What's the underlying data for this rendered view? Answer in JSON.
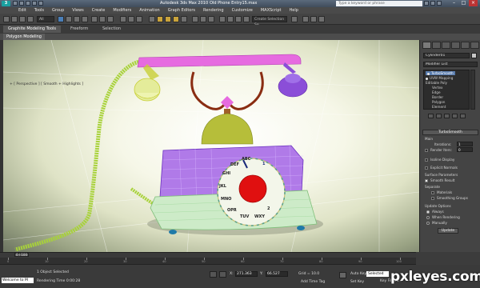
{
  "app": {
    "logo": "3",
    "title": "Autodesk 3ds Max  2010",
    "file": "Old Phone Entry15.max",
    "search_placeholder": "Type a keyword or phrase",
    "window_buttons": [
      "–",
      "□",
      "×"
    ]
  },
  "menubar": [
    "Edit",
    "Tools",
    "Group",
    "Views",
    "Create",
    "Modifiers",
    "Animation",
    "Graph Editors",
    "Rendering",
    "Customize",
    "MAXScript",
    "Help"
  ],
  "toolbar": {
    "selection_set": "Create Selection Se",
    "filter": "All"
  },
  "ribbon": {
    "tabs": [
      "Graphite Modeling Tools",
      "Freeform",
      "Selection"
    ],
    "subtab": "Polygon Modeling"
  },
  "viewport": {
    "label": "+ [ Perspective ] [ Smooth + Highlights ]"
  },
  "dial": {
    "letters": [
      "ABC",
      "DEF",
      "GHI",
      "JKL",
      "MNO",
      "PRS",
      "TUV",
      "WXY",
      "OPR",
      "TUV"
    ],
    "numbers": [
      "1",
      "2",
      "3",
      "4",
      "5",
      "6",
      "7",
      "8",
      "9",
      "0"
    ]
  },
  "command_panel": {
    "object_name": "Cylinder01",
    "modifier_list": "Modifier List",
    "stack": [
      {
        "label": "TurboSmooth",
        "selected": true
      },
      {
        "label": "UVW Mapping",
        "selected": false
      },
      {
        "label": "Editable Poly",
        "selected": false
      },
      {
        "label": "Vertex",
        "selected": false
      },
      {
        "label": "Edge",
        "selected": false
      },
      {
        "label": "Border",
        "selected": false
      },
      {
        "label": "Polygon",
        "selected": false
      },
      {
        "label": "Element",
        "selected": false
      }
    ],
    "rollout_title": "TurboSmooth",
    "main_label": "Main",
    "iterations_label": "Iterations:",
    "iterations_value": "1",
    "render_iters_label": "Render Iters:",
    "render_iters_value": "0",
    "isoline_label": "Isoline Display",
    "explicit_normals_label": "Explicit Normals",
    "surface_params_label": "Surface Parameters",
    "smooth_result_label": "Smooth Result",
    "separate_label": "Separate",
    "materials_label": "Materials",
    "smoothing_groups_label": "Smoothing Groups",
    "update_options_label": "Update Options",
    "always_label": "Always",
    "when_rendering_label": "When Rendering",
    "manually_label": "Manually",
    "update_button": "Update"
  },
  "timeline": {
    "frame": "0 / 100",
    "ticks": [
      "0",
      "10",
      "20",
      "30",
      "40",
      "50",
      "60",
      "70",
      "80",
      "90",
      "100"
    ]
  },
  "status": {
    "maxscript": "Welcome to M",
    "selection": "1 Object Selected",
    "rendering_time": "Rendering Time 0:00:28",
    "x_label": "X:",
    "x_value": "271.363",
    "y_label": "Y:",
    "y_value": "66.527",
    "z_label": "Z:",
    "z_value": "0.0",
    "grid": "Grid = 10.0",
    "add_time_tag": "Add Time Tag",
    "auto_key": "Auto Key",
    "set_key": "Set Key",
    "selected": "Selected",
    "key_filters": "Key Filters..."
  },
  "watermark": "pxleyes.com",
  "colors": {
    "cord": "#a8d23a",
    "handset": "#e66be0",
    "gold": "#c8cf37",
    "base_purple": "#8b4ed8",
    "dial_red": "#e01010"
  }
}
